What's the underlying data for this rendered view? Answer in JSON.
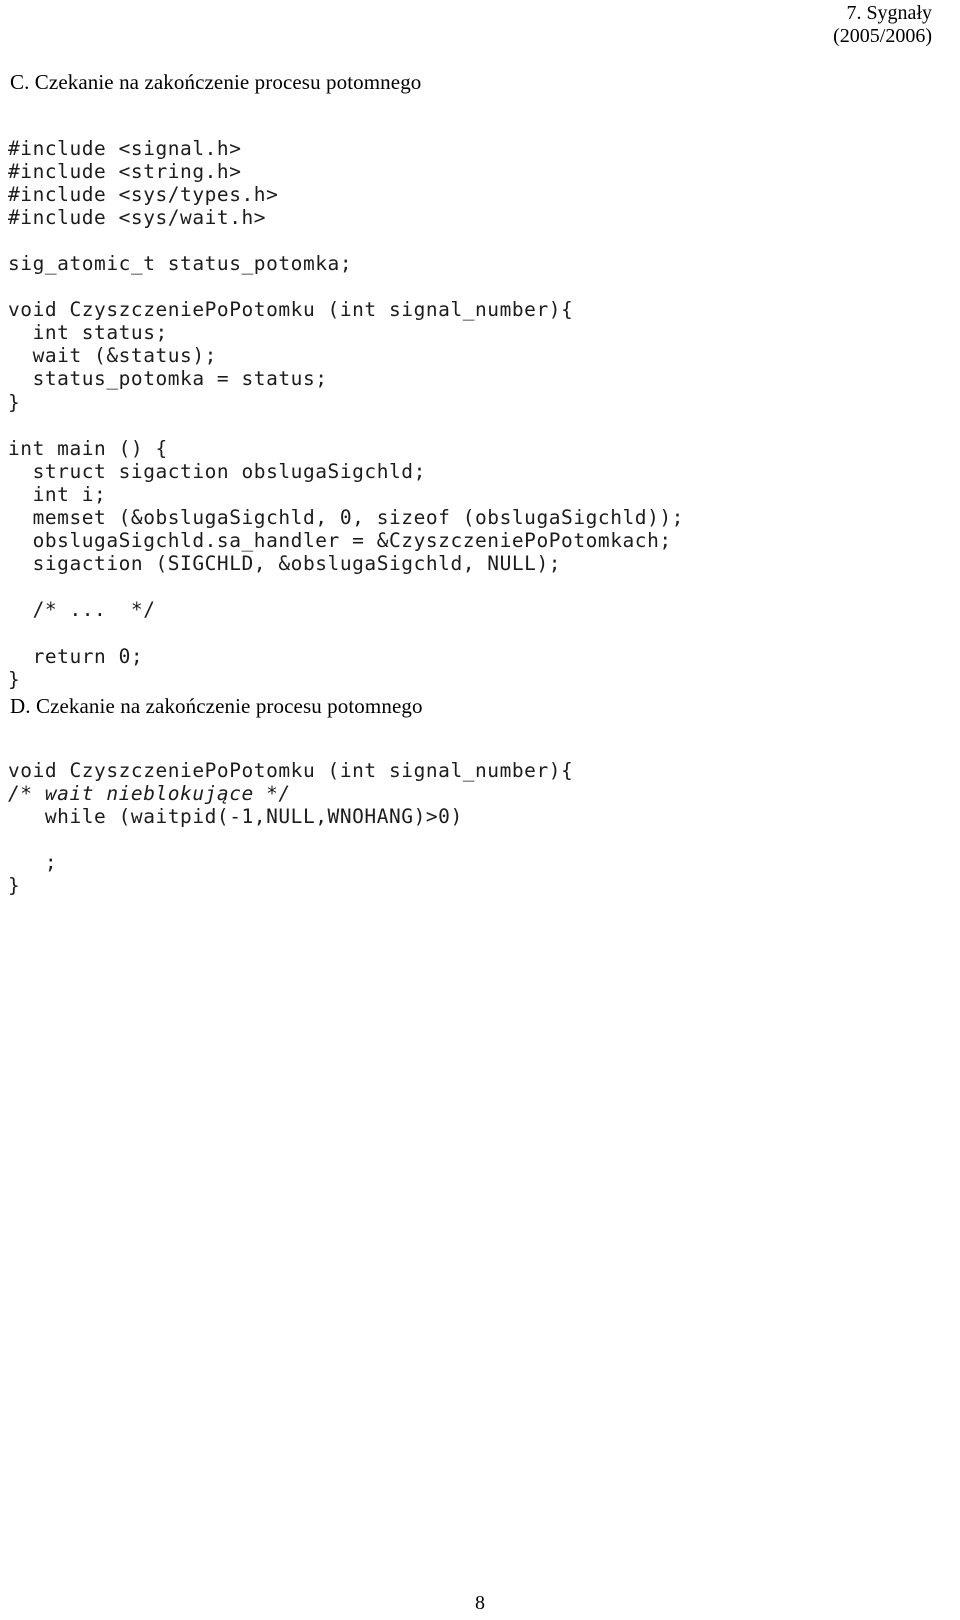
{
  "header": {
    "line1": "7. Sygnały",
    "line2": "(2005/2006)"
  },
  "sections": [
    {
      "id": "C",
      "heading": "C. Czekanie na zakończenie procesu potomnego",
      "code_lines": [
        {
          "text": "#include <signal.h>",
          "italic": false
        },
        {
          "text": "#include <string.h>",
          "italic": false
        },
        {
          "text": "#include <sys/types.h>",
          "italic": false
        },
        {
          "text": "#include <sys/wait.h>",
          "italic": false
        },
        {
          "text": "",
          "italic": false
        },
        {
          "text": "sig_atomic_t status_potomka;",
          "italic": false
        },
        {
          "text": "",
          "italic": false
        },
        {
          "text": "void CzyszczeniePoPotomku (int signal_number){",
          "italic": false
        },
        {
          "text": "  int status;",
          "italic": false
        },
        {
          "text": "  wait (&status);",
          "italic": false
        },
        {
          "text": "  status_potomka = status;",
          "italic": false
        },
        {
          "text": "}",
          "italic": false
        },
        {
          "text": "",
          "italic": false
        },
        {
          "text": "int main () {",
          "italic": false
        },
        {
          "text": "  struct sigaction obslugaSigchld;",
          "italic": false
        },
        {
          "text": "  int i;",
          "italic": false
        },
        {
          "text": "  memset (&obslugaSigchld, 0, sizeof (obslugaSigchld));",
          "italic": false
        },
        {
          "text": "  obslugaSigchld.sa_handler = &CzyszczeniePoPotomkach;",
          "italic": false
        },
        {
          "text": "  sigaction (SIGCHLD, &obslugaSigchld, NULL);",
          "italic": false
        },
        {
          "text": "",
          "italic": false
        },
        {
          "text": "  /* ...  */",
          "italic": false
        },
        {
          "text": "",
          "italic": false
        },
        {
          "text": "  return 0;",
          "italic": false
        },
        {
          "text": "}",
          "italic": false
        }
      ]
    },
    {
      "id": "D",
      "heading": "D. Czekanie na zakończenie procesu potomnego",
      "code_lines": [
        {
          "text": "void CzyszczeniePoPotomku (int signal_number){",
          "italic": false
        },
        {
          "text": "/* wait nieblokujące */",
          "italic": true
        },
        {
          "text": "   while (waitpid(-1,NULL,WNOHANG)>0)",
          "italic": false
        },
        {
          "text": "",
          "italic": false
        },
        {
          "text": "   ;",
          "italic": false
        },
        {
          "text": "}",
          "italic": false
        }
      ]
    }
  ],
  "footer": {
    "page_number": "8"
  },
  "colors": {
    "page_background": "#ffffff",
    "text": "#000000",
    "code_text": "#1c1c1c"
  }
}
